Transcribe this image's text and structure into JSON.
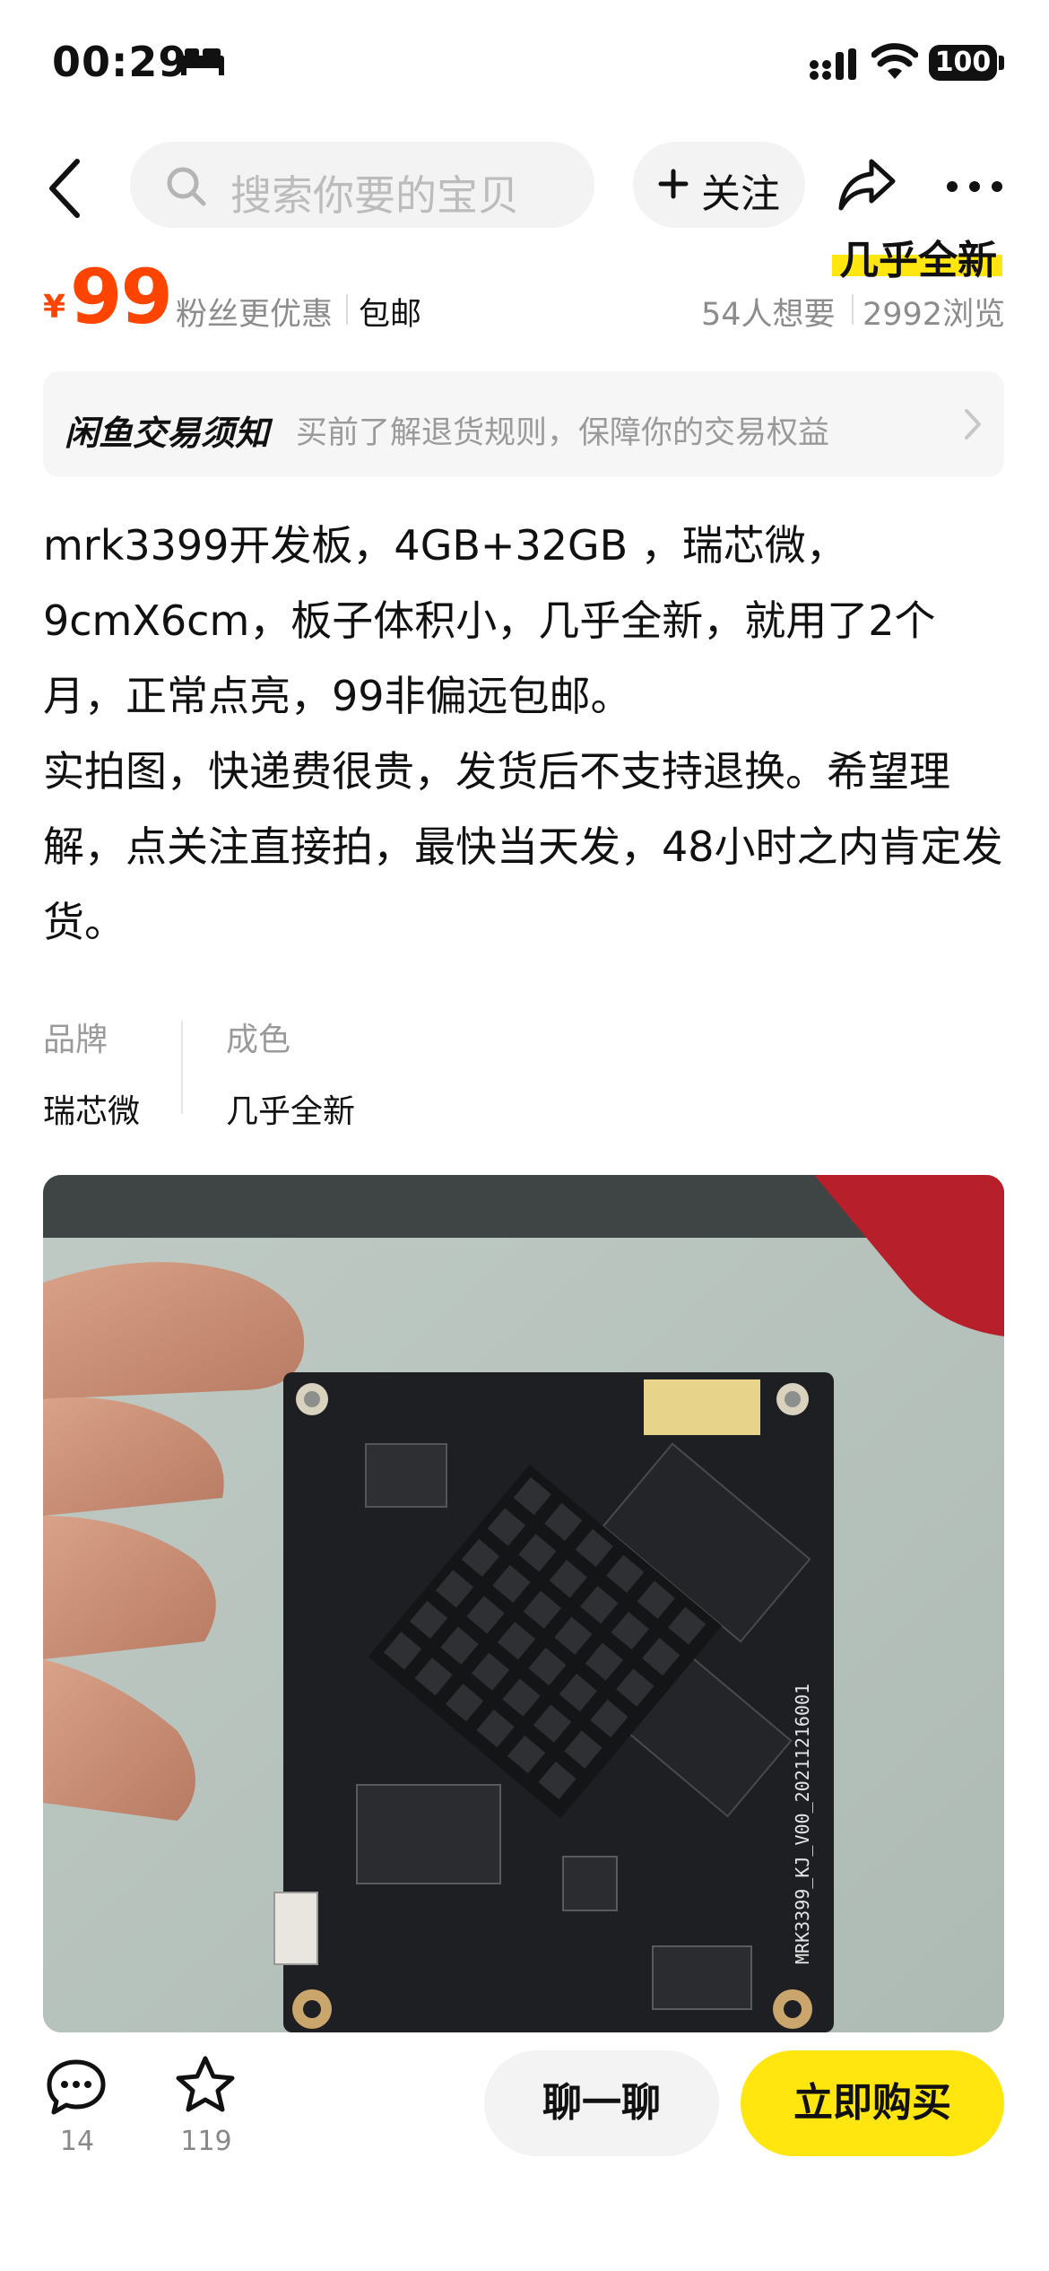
{
  "status_bar": {
    "time": "00:29",
    "battery": "100"
  },
  "header": {
    "search_placeholder": "搜索你要的宝贝",
    "follow_label": "关注"
  },
  "price_row": {
    "condition_tag": "几乎全新",
    "currency": "¥",
    "price": "99",
    "fans_text": "粉丝更优惠",
    "shipping": "包邮",
    "want_count": "54人想要",
    "views": "2992浏览"
  },
  "notice": {
    "title": "闲鱼交易须知",
    "description": "买前了解退货规则，保障你的交易权益"
  },
  "description": {
    "paragraph_1": "mrk3399开发板，4GB+32GB ，瑞芯微，9cmX6cm，板子体积小，几乎全新，就用了2个月，正常点亮，99非偏远包邮。",
    "paragraph_2": "实拍图，快递费很贵，发货后不支持退换。希望理解，点关注直接拍，最快当天发，48小时之内肯定发货。"
  },
  "attributes": [
    {
      "label": "品牌",
      "value": "瑞芯微"
    },
    {
      "label": "成色",
      "value": "几乎全新"
    }
  ],
  "product_image": {
    "board_silkscreen": "MRK3399_KJ_V00_20211216001"
  },
  "bottom_bar": {
    "comment_count": "14",
    "favorite_count": "119",
    "chat_label": "聊一聊",
    "buy_label": "立即购买"
  },
  "colors": {
    "price": "#ff4400",
    "accent_yellow": "#ffe60f"
  },
  "icons": [
    "bed-icon",
    "signal-icon",
    "wifi-icon",
    "back-arrow-icon",
    "search-icon",
    "plus-icon",
    "share-icon",
    "more-icon",
    "chevron-right-icon",
    "comment-icon",
    "star-icon"
  ]
}
